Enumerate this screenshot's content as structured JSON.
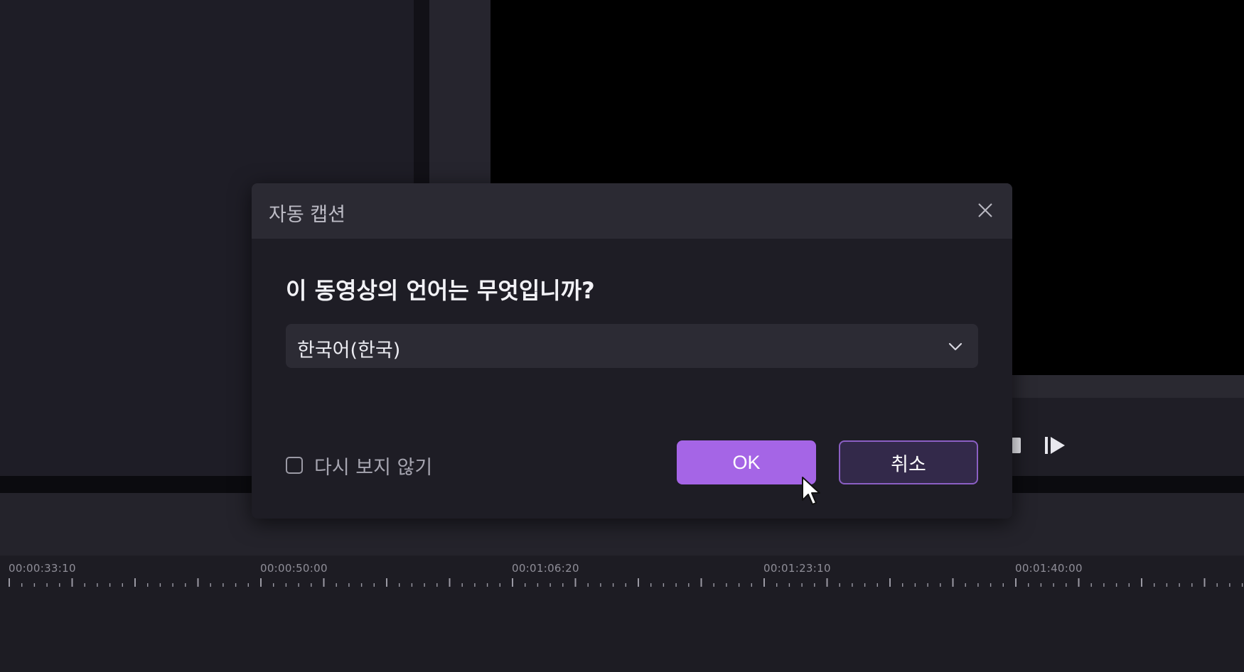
{
  "dialog": {
    "title": "자동 캡션",
    "question": "이 동영상의 언어는 무엇입니까?",
    "language_select": {
      "selected": "한국어(한국)"
    },
    "dont_show_again": {
      "label": "다시 보지 않기",
      "checked": false
    },
    "ok_label": "OK",
    "cancel_label": "취소"
  },
  "timeline": {
    "timecodes": [
      "00:00:33:10",
      "00:00:50:00",
      "00:01:06:20",
      "00:01:23:10",
      "00:01:40:00"
    ]
  },
  "colors": {
    "accent": "#a565e6",
    "cancel_bg": "#33294a",
    "cancel_border": "#8b5fc4",
    "dialog_bg": "#1e1d25",
    "dialog_header_bg": "#2b2a33"
  },
  "icons": {
    "close": "close-icon",
    "dropdown": "chevron-down-icon",
    "stop": "stop-icon",
    "play": "play-icon",
    "cursor": "mouse-cursor-icon"
  }
}
